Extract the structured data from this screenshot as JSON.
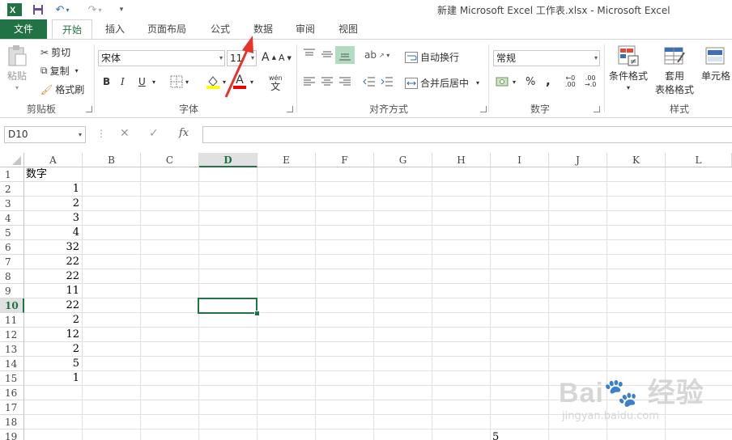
{
  "window": {
    "title": "新建 Microsoft Excel 工作表.xlsx - Microsoft Excel"
  },
  "quick_access": {
    "excel_icon": "excel-logo-icon",
    "save_icon": "save-icon",
    "undo_icon": "undo-icon",
    "redo_icon": "redo-icon",
    "customize_icon": "customize-icon"
  },
  "tabs": [
    "文件",
    "开始",
    "插入",
    "页面布局",
    "公式",
    "数据",
    "审阅",
    "视图"
  ],
  "active_tab": "开始",
  "ribbon": {
    "clipboard": {
      "paste": "粘贴",
      "cut": "剪切",
      "copy": "复制",
      "format_painter": "格式刷",
      "label": "剪贴板"
    },
    "font": {
      "font_name": "宋体",
      "font_size": "11",
      "bold": "B",
      "italic": "I",
      "underline": "U",
      "label": "字体",
      "wen": "wén"
    },
    "alignment": {
      "wrap_text": "自动换行",
      "merge_center": "合并后居中",
      "label": "对齐方式"
    },
    "number": {
      "format": "常规",
      "percent": "%",
      "comma": ",",
      "label": "数字"
    },
    "styles": {
      "conditional": "条件格式",
      "table_format_1": "套用",
      "table_format_2": "表格格式",
      "cell_styles": "单元格",
      "label": "样式"
    }
  },
  "formula_bar": {
    "name_box": "D10",
    "fx": "fx",
    "formula": ""
  },
  "columns": [
    "A",
    "B",
    "C",
    "D",
    "E",
    "F",
    "G",
    "H",
    "I",
    "J",
    "K",
    "L"
  ],
  "selected_column": "D",
  "selected_row": "10",
  "rows": [
    "1",
    "2",
    "3",
    "4",
    "5",
    "6",
    "7",
    "8",
    "9",
    "10",
    "11",
    "12",
    "13",
    "14",
    "15",
    "16",
    "17",
    "18",
    "19"
  ],
  "column_a": [
    "数字",
    "1",
    "2",
    "3",
    "4",
    "32",
    "22",
    "22",
    "11",
    "22",
    "2",
    "12",
    "2",
    "5",
    "1"
  ],
  "cell_i19": "5",
  "colors": {
    "accent": "#217346",
    "arrow": "#e8322b"
  }
}
